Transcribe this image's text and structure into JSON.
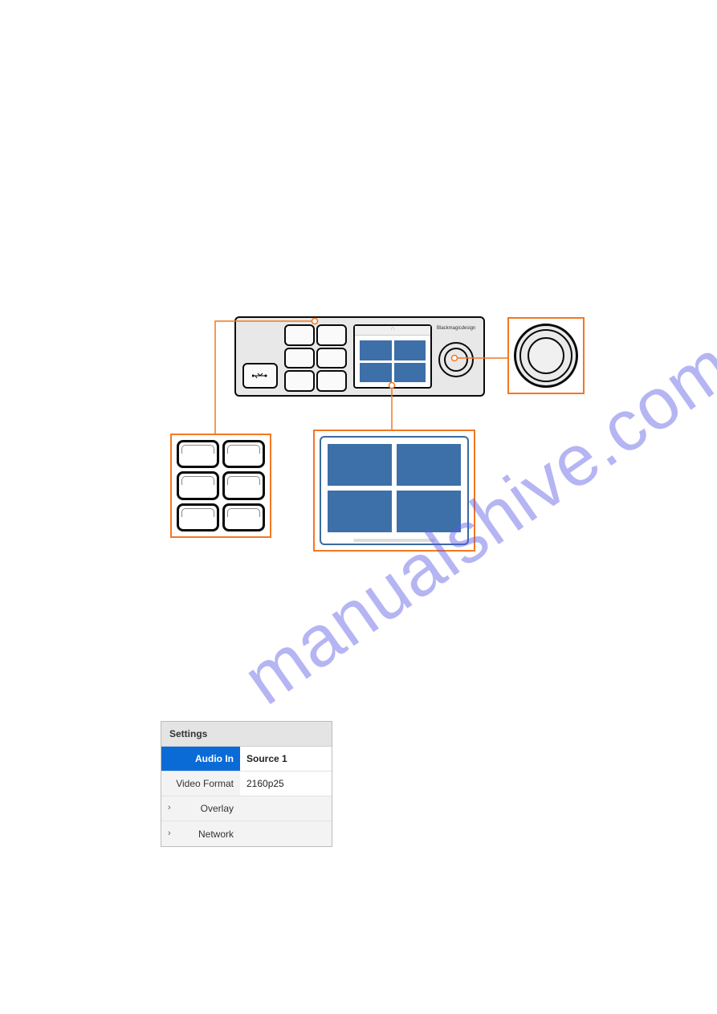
{
  "watermark": "manualshive.com",
  "device": {
    "brand": "Blackmagicdesign",
    "usb_glyph": "⎋",
    "headphone_glyph": "∩"
  },
  "settings": {
    "title": "Settings",
    "rows": [
      {
        "label": "Audio In",
        "value": "Source 1",
        "selected": true
      },
      {
        "label": "Video Format",
        "value": "2160p25",
        "selected": false
      },
      {
        "label": "Overlay",
        "submenu": true
      },
      {
        "label": "Network",
        "submenu": true
      }
    ]
  }
}
